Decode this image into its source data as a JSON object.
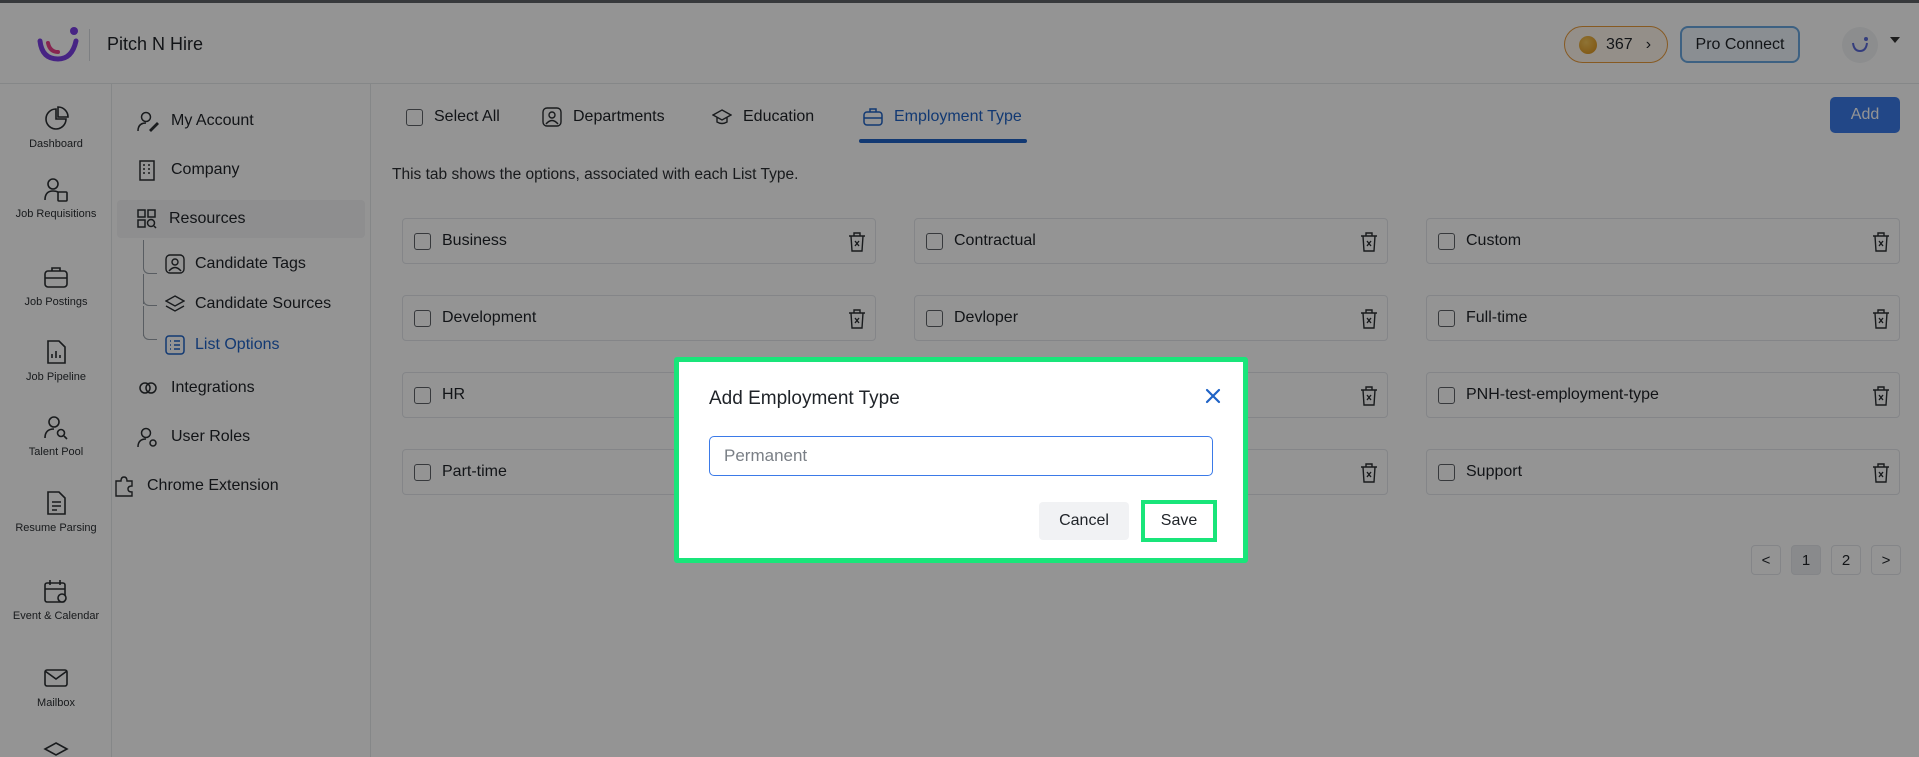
{
  "header": {
    "app_name": "Pitch N Hire",
    "coins": "367",
    "pro_connect_label": "Pro Connect"
  },
  "rail": {
    "items": [
      {
        "label": "Dashboard",
        "icon": "pie-chart-icon"
      },
      {
        "label": "Job Requisitions",
        "icon": "user-doc-icon"
      },
      {
        "label": "Job Postings",
        "icon": "briefcase-icon"
      },
      {
        "label": "Job Pipeline",
        "icon": "file-chart-icon"
      },
      {
        "label": "Talent Pool",
        "icon": "user-search-icon"
      },
      {
        "label": "Resume Parsing",
        "icon": "document-icon"
      },
      {
        "label": "Event & Calendar",
        "icon": "calendar-icon"
      },
      {
        "label": "Mailbox",
        "icon": "mail-icon"
      }
    ]
  },
  "sidebar": {
    "my_account": "My Account",
    "company": "Company",
    "resources": "Resources",
    "candidate_tags": "Candidate Tags",
    "candidate_sources": "Candidate Sources",
    "list_options": "List Options",
    "integrations": "Integrations",
    "user_roles": "User Roles",
    "chrome_extension": "Chrome Extension"
  },
  "tabs": {
    "select_all": "Select All",
    "departments": "Departments",
    "education": "Education",
    "employment_type": "Employment Type",
    "active": "Employment Type"
  },
  "main": {
    "add_label": "Add",
    "hint": "This tab shows the options, associated with each List Type."
  },
  "options": [
    "Business",
    "Contractual",
    "Custom",
    "Development",
    "Devloper",
    "Full-time",
    "HR",
    "PNH-test-employment-type",
    "Part-time",
    "Support"
  ],
  "pagination": {
    "prev": "<",
    "pages": [
      "1",
      "2"
    ],
    "current": "1",
    "next": ">"
  },
  "modal": {
    "title": "Add Employment Type",
    "input_placeholder": "Permanent",
    "input_value": "",
    "cancel_label": "Cancel",
    "save_label": "Save"
  },
  "colors": {
    "accent": "#1f63c6",
    "add_button": "#3b7ae8",
    "highlight": "#19e57a"
  }
}
